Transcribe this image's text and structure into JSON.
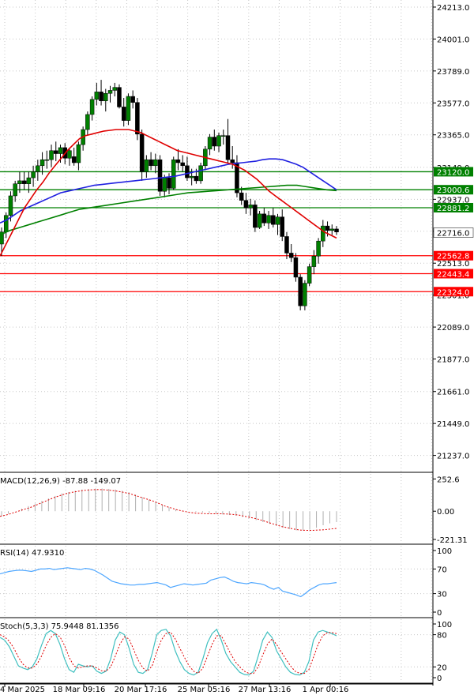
{
  "chart_data": [
    {
      "type": "candlestick",
      "x_tick_labels": [
        "4 Mar 2025",
        "18 Mar 09:16",
        "20 Mar 17:16",
        "25 Mar 05:16",
        "27 Mar 13:16",
        "1 Apr 00:16"
      ],
      "y_tick_labels": [
        "24213.0",
        "24001.0",
        "23789.0",
        "23577.0",
        "23365.0",
        "23149.0",
        "22937.0",
        "22725.0",
        "22513.0",
        "22301.0",
        "22089.0",
        "21877.0",
        "21661.0",
        "21449.0",
        "21237.0"
      ],
      "ylim": [
        21130,
        24260
      ],
      "grid": true,
      "current_price": "22716.0",
      "levels": [
        {
          "label": "23120.0",
          "value": 23120,
          "color": "#008000"
        },
        {
          "label": "23000.6",
          "value": 23000.6,
          "color": "#008000"
        },
        {
          "label": "22881.2",
          "value": 22881.2,
          "color": "#008000"
        },
        {
          "label": "22562.8",
          "value": 22562.8,
          "color": "#ff0000"
        },
        {
          "label": "22443.4",
          "value": 22443.4,
          "color": "#ff0000"
        },
        {
          "label": "22324.0",
          "value": 22324.0,
          "color": "#ff0000"
        }
      ],
      "candles": [
        [
          22640,
          22750,
          22560,
          22720
        ],
        [
          22720,
          22850,
          22680,
          22830
        ],
        [
          22830,
          22990,
          22790,
          22960
        ],
        [
          22960,
          23060,
          22920,
          23040
        ],
        [
          23040,
          23120,
          22980,
          23060
        ],
        [
          23060,
          23120,
          23000,
          23040
        ],
        [
          23040,
          23120,
          22980,
          23080
        ],
        [
          23080,
          23160,
          23020,
          23120
        ],
        [
          23120,
          23200,
          23060,
          23160
        ],
        [
          23160,
          23250,
          23100,
          23200
        ],
        [
          23200,
          23260,
          23140,
          23200
        ],
        [
          23200,
          23300,
          23150,
          23260
        ],
        [
          23260,
          23320,
          23190,
          23240
        ],
        [
          23240,
          23300,
          23180,
          23280
        ],
        [
          23280,
          23310,
          23170,
          23210
        ],
        [
          23210,
          23280,
          23160,
          23260
        ],
        [
          23220,
          23280,
          23160,
          23180
        ],
        [
          23180,
          23320,
          23130,
          23300
        ],
        [
          23300,
          23420,
          23260,
          23400
        ],
        [
          23400,
          23520,
          23360,
          23500
        ],
        [
          23500,
          23620,
          23460,
          23600
        ],
        [
          23600,
          23710,
          23560,
          23650
        ],
        [
          23650,
          23730,
          23560,
          23590
        ],
        [
          23590,
          23670,
          23520,
          23640
        ],
        [
          23640,
          23690,
          23580,
          23660
        ],
        [
          23660,
          23710,
          23620,
          23680
        ],
        [
          23680,
          23700,
          23540,
          23550
        ],
        [
          23550,
          23610,
          23420,
          23460
        ],
        [
          23460,
          23640,
          23430,
          23620
        ],
        [
          23620,
          23660,
          23540,
          23580
        ],
        [
          23580,
          23610,
          23330,
          23370
        ],
        [
          23370,
          23400,
          23060,
          23120
        ],
        [
          23120,
          23230,
          23080,
          23200
        ],
        [
          23200,
          23250,
          23130,
          23160
        ],
        [
          23160,
          23240,
          23110,
          23200
        ],
        [
          23200,
          23230,
          22960,
          22990
        ],
        [
          22990,
          23100,
          22950,
          23080
        ],
        [
          23080,
          23110,
          22970,
          23010
        ],
        [
          23010,
          23220,
          23000,
          23200
        ],
        [
          23200,
          23270,
          23130,
          23180
        ],
        [
          23180,
          23230,
          23120,
          23160
        ],
        [
          23160,
          23220,
          23060,
          23080
        ],
        [
          23080,
          23140,
          23030,
          23090
        ],
        [
          23090,
          23140,
          23040,
          23060
        ],
        [
          23060,
          23180,
          23040,
          23160
        ],
        [
          23160,
          23290,
          23130,
          23270
        ],
        [
          23270,
          23370,
          23230,
          23350
        ],
        [
          23350,
          23400,
          23260,
          23290
        ],
        [
          23290,
          23380,
          23250,
          23360
        ],
        [
          23360,
          23400,
          23300,
          23360
        ],
        [
          23360,
          23470,
          23180,
          23200
        ],
        [
          23200,
          23290,
          23140,
          23180
        ],
        [
          23180,
          23230,
          22950,
          22980
        ],
        [
          22980,
          23020,
          22900,
          22930
        ],
        [
          22930,
          22980,
          22840,
          22880
        ],
        [
          22880,
          22940,
          22830,
          22900
        ],
        [
          22900,
          22930,
          22720,
          22750
        ],
        [
          22750,
          22860,
          22740,
          22840
        ],
        [
          22840,
          22880,
          22760,
          22780
        ],
        [
          22780,
          22860,
          22740,
          22830
        ],
        [
          22830,
          22880,
          22750,
          22770
        ],
        [
          22770,
          22840,
          22700,
          22820
        ],
        [
          22820,
          22870,
          22660,
          22690
        ],
        [
          22690,
          22720,
          22540,
          22580
        ],
        [
          22580,
          22640,
          22520,
          22550
        ],
        [
          22550,
          22580,
          22390,
          22420
        ],
        [
          22420,
          22440,
          22200,
          22230
        ],
        [
          22230,
          22400,
          22200,
          22380
        ],
        [
          22380,
          22510,
          22360,
          22490
        ],
        [
          22490,
          22600,
          22440,
          22560
        ],
        [
          22560,
          22680,
          22510,
          22660
        ],
        [
          22660,
          22800,
          22620,
          22760
        ],
        [
          22760,
          22790,
          22690,
          22730
        ],
        [
          22730,
          22770,
          22700,
          22740
        ],
        [
          22740,
          22760,
          22700,
          22720
        ]
      ],
      "ma_red": [
        22560,
        22640,
        22720,
        22800,
        22880,
        22940,
        23000,
        23050,
        23110,
        23160,
        23210,
        23260,
        23300,
        23340,
        23360,
        23370,
        23380,
        23390,
        23395,
        23400,
        23400,
        23400,
        23390,
        23380,
        23360,
        23340,
        23320,
        23300,
        23280,
        23260,
        23250,
        23240,
        23230,
        23220,
        23210,
        23200,
        23190,
        23180,
        23170,
        23150,
        23130,
        23100,
        23070,
        23030,
        22990,
        22960,
        22930,
        22900,
        22870,
        22840,
        22810,
        22780,
        22750,
        22720,
        22700,
        22680
      ],
      "ma_blue": [
        22780,
        22800,
        22830,
        22860,
        22880,
        22900,
        22920,
        22940,
        22960,
        22980,
        22990,
        23000,
        23010,
        23020,
        23030,
        23035,
        23040,
        23045,
        23050,
        23055,
        23060,
        23065,
        23070,
        23075,
        23080,
        23085,
        23090,
        23100,
        23110,
        23120,
        23130,
        23140,
        23150,
        23160,
        23170,
        23175,
        23180,
        23185,
        23190,
        23200,
        23205,
        23205,
        23200,
        23185,
        23170,
        23150,
        23120,
        23090,
        23060,
        23030,
        23000
      ],
      "ma_green": [
        22700,
        22730,
        22750,
        22770,
        22790,
        22810,
        22830,
        22850,
        22870,
        22880,
        22890,
        22900,
        22910,
        22920,
        22930,
        22940,
        22950,
        22960,
        22970,
        22980,
        22985,
        22990,
        22995,
        23000,
        23005,
        23010,
        23015,
        23020,
        23025,
        23030,
        23030,
        23020,
        23010,
        23000,
        22995
      ]
    },
    {
      "type": "bar",
      "name": "MACD(12,26,9)",
      "title": "MACD(12,26,9) -87.88 -149.07",
      "y_tick_labels": [
        "252.6",
        "0.00",
        "-221.31"
      ],
      "ylim": [
        -240,
        280
      ],
      "histogram": [
        -40,
        -20,
        0,
        20,
        40,
        60,
        80,
        100,
        120,
        140,
        150,
        160,
        170,
        175,
        178,
        178,
        175,
        170,
        160,
        150,
        130,
        110,
        90,
        70,
        50,
        30,
        15,
        5,
        0,
        -5,
        -10,
        -15,
        -20,
        -25,
        -30,
        -35,
        -45,
        -55,
        -70,
        -85,
        -100,
        -115,
        -130,
        -140,
        -150,
        -150,
        -145,
        -130,
        -110,
        -95,
        -85
      ],
      "signal": [
        -40,
        -30,
        -15,
        0,
        15,
        30,
        50,
        70,
        90,
        110,
        125,
        140,
        150,
        158,
        164,
        168,
        170,
        168,
        164,
        158,
        150,
        140,
        125,
        110,
        95,
        80,
        60,
        40,
        25,
        10,
        0,
        -10,
        -15,
        -18,
        -20,
        -20,
        -20,
        -22,
        -25,
        -30,
        -40,
        -50,
        -60,
        -75,
        -90,
        -105,
        -120,
        -130,
        -140,
        -148,
        -150,
        -150,
        -148,
        -145,
        -140,
        -135
      ]
    },
    {
      "type": "line",
      "name": "RSI(14)",
      "title": "RSI(14) 47.9310",
      "y_tick_labels": [
        "100",
        "70",
        "30",
        "0"
      ],
      "ylim": [
        0,
        100
      ],
      "values": [
        62,
        64,
        66,
        67,
        68,
        68,
        67,
        66,
        68,
        70,
        70,
        71,
        69,
        70,
        71,
        72,
        71,
        70,
        69,
        71,
        70,
        68,
        64,
        60,
        55,
        50,
        48,
        46,
        45,
        44,
        44,
        45,
        45,
        46,
        47,
        48,
        46,
        44,
        40,
        42,
        44,
        46,
        45,
        44,
        45,
        46,
        47,
        52,
        54,
        56,
        57,
        54,
        50,
        48,
        47,
        46,
        48,
        47,
        46,
        44,
        40,
        37,
        40,
        34,
        32,
        30,
        28,
        25,
        30,
        36,
        40,
        44,
        46,
        46,
        47,
        48
      ]
    },
    {
      "type": "line",
      "name": "Stoch(5,3,3)",
      "title": "Stoch(5,3,3) 75.9448 81.1356",
      "y_tick_labels": [
        "100",
        "80",
        "20",
        "0"
      ],
      "ylim": [
        0,
        100
      ],
      "main": [
        75,
        70,
        58,
        40,
        22,
        18,
        15,
        20,
        35,
        60,
        82,
        88,
        82,
        62,
        35,
        15,
        10,
        25,
        22,
        20,
        22,
        12,
        8,
        12,
        35,
        70,
        85,
        80,
        55,
        25,
        10,
        8,
        15,
        45,
        80,
        88,
        90,
        78,
        50,
        30,
        15,
        8,
        5,
        10,
        35,
        65,
        82,
        90,
        70,
        45,
        30,
        20,
        10,
        6,
        5,
        12,
        40,
        70,
        85,
        75,
        50,
        35,
        20,
        10,
        6,
        5,
        10,
        30,
        70,
        85,
        88,
        85,
        82,
        78
      ],
      "signal": [
        80,
        76,
        68,
        55,
        38,
        25,
        18,
        18,
        25,
        40,
        60,
        75,
        82,
        76,
        60,
        38,
        22,
        18,
        20,
        22,
        22,
        18,
        13,
        12,
        20,
        40,
        62,
        76,
        72,
        52,
        32,
        18,
        12,
        22,
        48,
        70,
        82,
        85,
        72,
        55,
        38,
        22,
        12,
        8,
        18,
        40,
        62,
        78,
        78,
        62,
        45,
        30,
        20,
        12,
        8,
        8,
        20,
        42,
        62,
        72,
        62,
        48,
        35,
        22,
        12,
        8,
        8,
        15,
        38,
        62,
        78,
        84,
        84,
        82
      ]
    }
  ]
}
